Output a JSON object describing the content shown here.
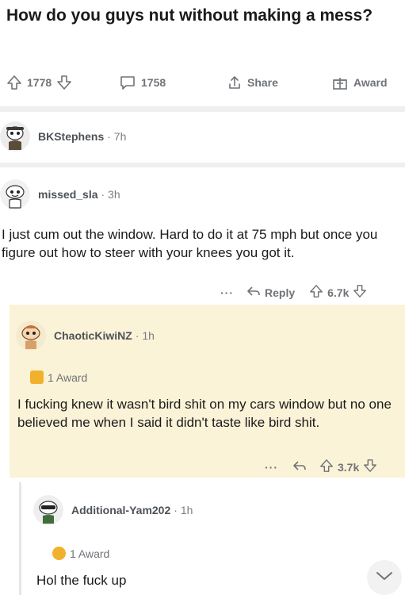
{
  "post": {
    "title": "How do you guys nut without making a mess?",
    "upvotes": "1778",
    "comments": "1758",
    "share_label": "Share",
    "award_label": "Award"
  },
  "comments": [
    {
      "username": "BKStephens",
      "time": "· 7h"
    },
    {
      "username": "missed_sla",
      "time": "· 3h",
      "text": "I just cum out the window. Hard to do it at 75 mph but once you figure out how to steer with your knees you got it.",
      "dots": "···",
      "reply_label": "Reply",
      "votes": "6.7k"
    },
    {
      "username": "ChaoticKiwiNZ",
      "time": "· 1h",
      "award": "1 Award",
      "text": "I fucking knew it wasn't bird shit on my cars window but no one believed me when I said it didn't taste like bird shit.",
      "dots": "···",
      "votes": "3.7k"
    },
    {
      "username": "Additional-Yam202",
      "time": "· 1h",
      "award": "1 Award",
      "text": "Hol the fuck up"
    }
  ],
  "colors": {
    "highlight": "#fbf3d8",
    "muted": "#6f7378",
    "award_gold": "#f2b12c"
  }
}
